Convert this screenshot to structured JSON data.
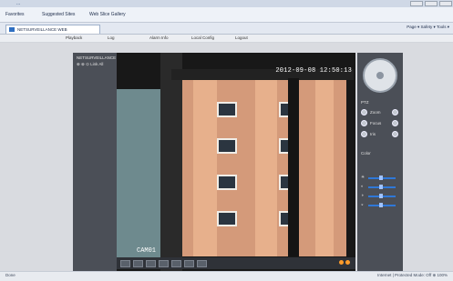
{
  "browser": {
    "title": "...",
    "favorites": [
      "Favorites",
      "Suggested Sites",
      "Web Slice Gallery"
    ],
    "tab_title": "NETSURVEILLANCE WEB",
    "command_bar": "Page ▾   Safety ▾   Tools ▾"
  },
  "app": {
    "menu": [
      "Playback",
      "Log",
      "Alarm Info",
      "Local Config",
      "Logout"
    ],
    "left_panel": {
      "header": "NETSURVEILLANCE",
      "actions": [
        "⊕",
        "⊗",
        "⊙",
        "Link All"
      ]
    },
    "video": {
      "timestamp": "2012-09-08 12:50:13",
      "channel": "CAM01"
    },
    "controls": [
      "⏹",
      "⏮",
      "⏸",
      "▶",
      "⏭",
      "⏺",
      "⚙"
    ],
    "right_panel": {
      "ptz_title": "PTZ",
      "labels": [
        "Zoom",
        "Focus",
        "Iris"
      ],
      "color_title": "Color",
      "slider_labels": [
        "☀",
        "◐",
        "◑",
        "◒"
      ]
    }
  },
  "status": {
    "left": "Done",
    "right": "Internet | Protected Mode: Off   ⊕ 100%"
  }
}
